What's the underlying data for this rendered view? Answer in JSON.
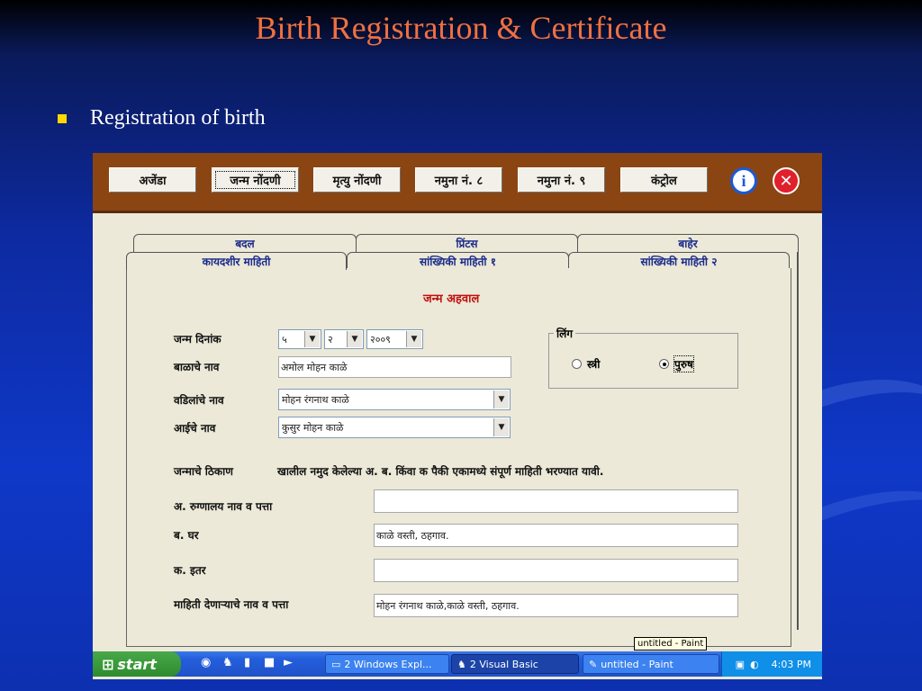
{
  "slide": {
    "title": "Birth Registration & Certificate",
    "bullet": "Registration of birth"
  },
  "toolbar": {
    "buttons": [
      "अजेंडा",
      "जन्म नोंदणी",
      "मृत्यु नोंदणी",
      "नमुना नं. ८",
      "नमुना नं. ९",
      "कंट्रोल"
    ]
  },
  "tabs": {
    "back": [
      "बदल",
      "प्रिंटस",
      "बाहेर"
    ],
    "front": [
      "कायदशीर माहिती",
      "सांख्यिकी माहिती १",
      "सांख्यिकी माहिती २"
    ]
  },
  "form": {
    "heading": "जन्म अहवाल",
    "birth_date_label": "जन्म दिनांक",
    "day": "५",
    "month": "२",
    "year": "२००९",
    "child_name_label": "बाळाचे नाव",
    "child_name": "अमोल मोहन काळे",
    "father_label": "वडिलांचे नाव",
    "father": "मोहन रंगनाथ काळे",
    "mother_label": "आईचे नाव",
    "mother": "कुसुर मोहन काळे",
    "gender_label": "लिंग",
    "female": "स्त्री",
    "male": "पुरुष",
    "selected_gender": "male",
    "place_label": "जन्माचे ठिकाण",
    "place_note": "खालील नमुद केलेल्या अ. ब. किंवा क पैकी एकामध्ये संपूर्ण माहिती भरण्यात यावी.",
    "hospital_label": "अ. रुग्णालय नाव व पत्ता",
    "hospital": "",
    "home_label": "ब. घर",
    "home": "काळे वस्ती, ठहगाव.",
    "other_label": "क. इतर",
    "other": "",
    "informant_label": "माहिती देणाऱ्याचे नाव व पत्ता",
    "informant": "मोहन रंगनाथ काळे,काळे वस्ती, ठहगाव."
  },
  "taskbar": {
    "start": "start",
    "tasks": [
      "2 Windows Expl...",
      "2 Visual Basic",
      "untitled - Paint"
    ],
    "time": "4:03 PM",
    "tooltip": "untitled - Paint"
  }
}
